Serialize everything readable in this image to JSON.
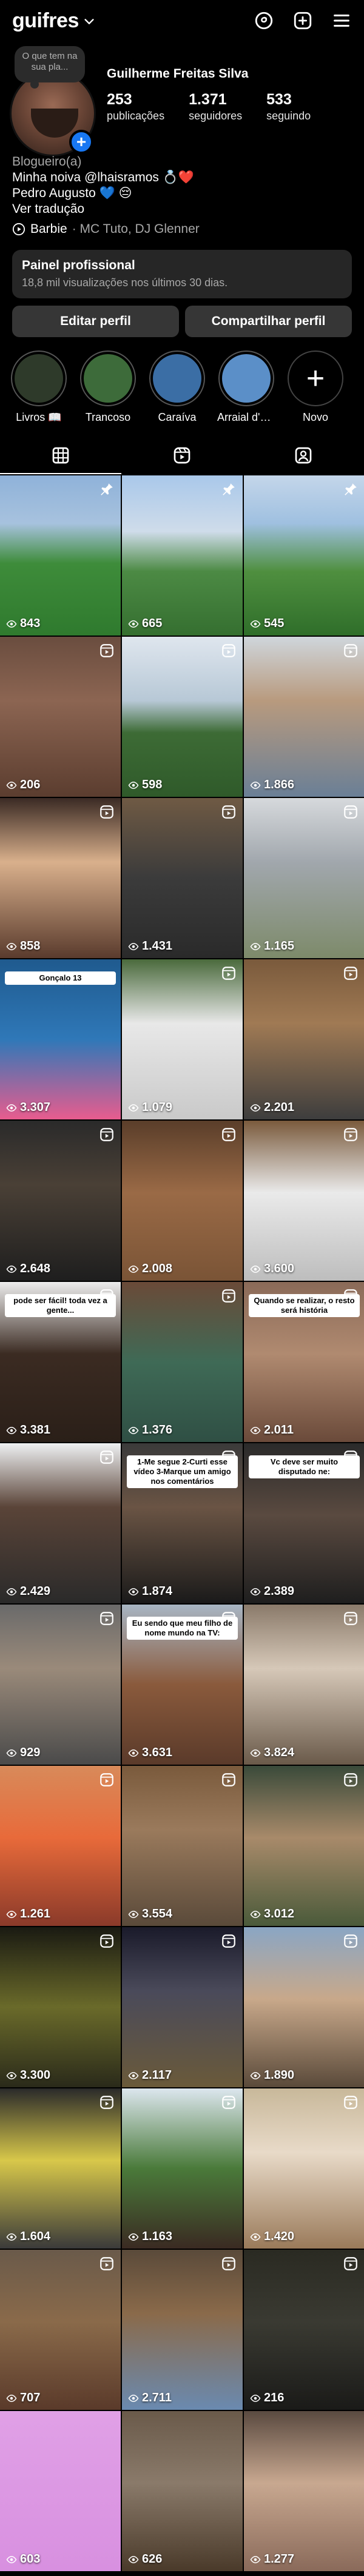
{
  "header": {
    "username": "guifres",
    "icons": [
      "threads-icon",
      "create-icon",
      "menu-icon"
    ]
  },
  "profile": {
    "note": "O que tem na sua pla...",
    "full_name": "Guilherme Freitas Silva",
    "stats": [
      {
        "num": "253",
        "label": "publicações"
      },
      {
        "num": "1.371",
        "label": "seguidores"
      },
      {
        "num": "533",
        "label": "seguindo"
      }
    ],
    "category": "Blogueiro(a)",
    "bio_line1": "Minha noiva @lhaisramos 💍❤️",
    "bio_line2": "Pedro Augusto 💙 😔",
    "translate": "Ver tradução",
    "music_title": "Barbie",
    "music_artists": "· MC Tuto, DJ Glenner",
    "dashboard_title": "Painel profissional",
    "dashboard_sub": "18,8 mil visualizações nos últimos 30 dias.",
    "edit_button": "Editar perfil",
    "share_button": "Compartilhar perfil"
  },
  "highlights": [
    {
      "label": "Livros 📖",
      "color": "#2e3a2a"
    },
    {
      "label": "Trancoso",
      "color": "#3d6b3a"
    },
    {
      "label": "Caraíva",
      "color": "#3b6ea5"
    },
    {
      "label": "Arraial d'Aju...",
      "color": "#5b8fc8"
    },
    {
      "label": "Novo",
      "color": ""
    }
  ],
  "tabs": [
    "grid-tab",
    "reels-tab",
    "tagged-tab"
  ],
  "grid": [
    {
      "views": "843",
      "bg": "linear-gradient(#8fb2d9 0%, #a7c2de 30%, #3e8c3a 55%, #2f7a2e 100%)",
      "badge": "pin"
    },
    {
      "views": "665",
      "bg": "linear-gradient(#a9c8ea 0%, #cfdcea 35%, #4c8a44 60%, #356f30 100%)",
      "badge": "pin"
    },
    {
      "views": "545",
      "bg": "linear-gradient(#c4d6ea 0%, #9fc0e0 30%, #4f8f3f 60%, #2f6e2a 100%)",
      "badge": "pin"
    },
    {
      "views": "206",
      "bg": "linear-gradient(#6a4d3f 0%, #8c6552 40%, #5b3d2f 100%)",
      "badge": "reel"
    },
    {
      "views": "598",
      "bg": "linear-gradient(#dfe6ee 0%, #b7c8d6 40%, #3d6b35 60%, #2f5a2a 100%)",
      "badge": "reel"
    },
    {
      "views": "1.866",
      "bg": "linear-gradient(#cfd6dc 0%, #b89a7e 40%, #6a7f96 100%)",
      "badge": "reel"
    },
    {
      "views": "858",
      "bg": "linear-gradient(#3a2a24 0%, #d9b08c 40%, #5a3b2d 100%)",
      "badge": "reel"
    },
    {
      "views": "1.431",
      "bg": "linear-gradient(#6f5a44 0%, #3b3b3b 50%, #2a2a2a 100%)",
      "badge": "reel"
    },
    {
      "views": "1.165",
      "bg": "linear-gradient(#d6d9dc 0%, #a1a7ad 40%, #7d8a6a 100%)",
      "badge": "reel"
    },
    {
      "views": "3.307",
      "bg": "linear-gradient(#1f5a8e 0%, #2f78b8 50%, #e85c8e 100%)",
      "badge": ""
    },
    {
      "views": "1.079",
      "bg": "linear-gradient(#4a6a3c 0%, #e8e8e8 40%, #c9c9c9 100%)",
      "badge": "reel"
    },
    {
      "views": "2.201",
      "bg": "linear-gradient(#7a5a3c 0%, #a07a54 40%, #3d3d3d 100%)",
      "badge": "reel"
    },
    {
      "views": "2.648",
      "bg": "linear-gradient(#2a2a2a 0%, #4a4036 40%, #1e1e1e 100%)",
      "badge": "reel"
    },
    {
      "views": "2.008",
      "bg": "linear-gradient(#5a3e2a 0%, #9a6a46 45%, #7a5436 100%)",
      "badge": "reel"
    },
    {
      "views": "3.600",
      "bg": "linear-gradient(#7a5a3c 0%, #eaeaea 45%, #bdbdbd 100%)",
      "badge": "reel"
    },
    {
      "views": "3.381",
      "bg": "linear-gradient(#ececec 0%, #3b2b22 45%, #2a1f18 100%)",
      "badge": "reel"
    },
    {
      "views": "1.376",
      "bg": "linear-gradient(#6a4a38 0%, #3f6a56 50%, #2f4f44 100%)",
      "badge": "reel"
    },
    {
      "views": "2.011",
      "bg": "linear-gradient(#8a6a58 0%, #b08a70 45%, #6a4a3a 100%)",
      "badge": "reel"
    },
    {
      "views": "2.429",
      "bg": "linear-gradient(#eef0f2 0%, #5a4438 40%, #2a2a2a 100%)",
      "badge": "reel"
    },
    {
      "views": "1.874",
      "bg": "linear-gradient(#3a3a3a 0%, #6a5444 40%, #1a1a1a 100%)",
      "badge": "reel"
    },
    {
      "views": "2.389",
      "bg": "linear-gradient(#2a2a2a 0%, #5a4a40 45%, #1e1e1e 100%)",
      "badge": "reel"
    },
    {
      "views": "929",
      "bg": "linear-gradient(#6a6a6a 0%, #9a8a7a 40%, #4a4a4a 100%)",
      "badge": "reel"
    },
    {
      "views": "3.631",
      "bg": "linear-gradient(#a8b6c4 0%, #8a5a3c 50%, #5a3a2a 100%)",
      "badge": "reel"
    },
    {
      "views": "3.824",
      "bg": "linear-gradient(#8a7a6a 0%, #d6c8b8 40%, #6a5a4a 100%)",
      "badge": "reel"
    },
    {
      "views": "1.261",
      "bg": "linear-gradient(#d88a5a 0%, #e86a3a 45%, #8a3a2a 100%)",
      "badge": "reel"
    },
    {
      "views": "3.554",
      "bg": "linear-gradient(#7a5a3c 0%, #9a7a5c 40%, #5a4a3a 100%)",
      "badge": "reel"
    },
    {
      "views": "3.012",
      "bg": "linear-gradient(#3a4a3a 0%, #a88a6a 45%, #4a5a3a 100%)",
      "badge": "reel"
    },
    {
      "views": "3.300",
      "bg": "linear-gradient(#1a1a12 0%, #6a6a2a 50%, #2a2a1a 100%)",
      "badge": "reel"
    },
    {
      "views": "2.117",
      "bg": "linear-gradient(#1a1a2a 0%, #4a4a5a 40%, #6a5a3a 100%)",
      "badge": "reel"
    },
    {
      "views": "1.890",
      "bg": "linear-gradient(#8aa6c4 0%, #c8a88a 45%, #5a4a3a 100%)",
      "badge": "reel"
    },
    {
      "views": "1.604",
      "bg": "linear-gradient(#2a2a2a 0%, #d8c84a 45%, #3a3a3a 100%)",
      "badge": "reel"
    },
    {
      "views": "1.163",
      "bg": "linear-gradient(#dce6ee 0%, #4a7a3a 50%, #3a2a22 100%)",
      "badge": "reel"
    },
    {
      "views": "1.420",
      "bg": "linear-gradient(#c8b89a 0%, #e8dac8 40%, #9a7a5a 100%)",
      "badge": "reel"
    },
    {
      "views": "707",
      "bg": "linear-gradient(#6a5a4a 0%, #8a6a4a 45%, #5a3a2a 100%)",
      "badge": "reel"
    },
    {
      "views": "2.711",
      "bg": "linear-gradient(#5a4a3a 0%, #8a6a4a 40%, #6a8ab0 100%)",
      "badge": "reel"
    },
    {
      "views": "216",
      "bg": "linear-gradient(#2a2a22 0%, #3a3a32 45%, #1a1a18 100%)",
      "badge": "reel"
    },
    {
      "views": "603",
      "bg": "linear-gradient(#e0a0e6 0%, #d890e0 100%)",
      "badge": ""
    },
    {
      "views": "626",
      "bg": "linear-gradient(#6a5a4a 0%, #8a7a6a 45%, #4a3a2a 100%)",
      "badge": ""
    },
    {
      "views": "1.277",
      "bg": "linear-gradient(#5a4a40 0%, #c8a890 45%, #8a6a5a 100%)",
      "badge": ""
    }
  ],
  "captions": {
    "t9": "Gonçalo 13",
    "t15": "pode ser fácil! toda vez a gente...",
    "t17": "Quando se realizar, o resto será história",
    "t19": "1-Me segue 2-Curti esse vídeo 3-Marque um amigo nos comentários",
    "t20": "Vc deve ser muito disputado ne:",
    "t22": "Eu sendo que meu filho de nome mundo na TV:"
  }
}
